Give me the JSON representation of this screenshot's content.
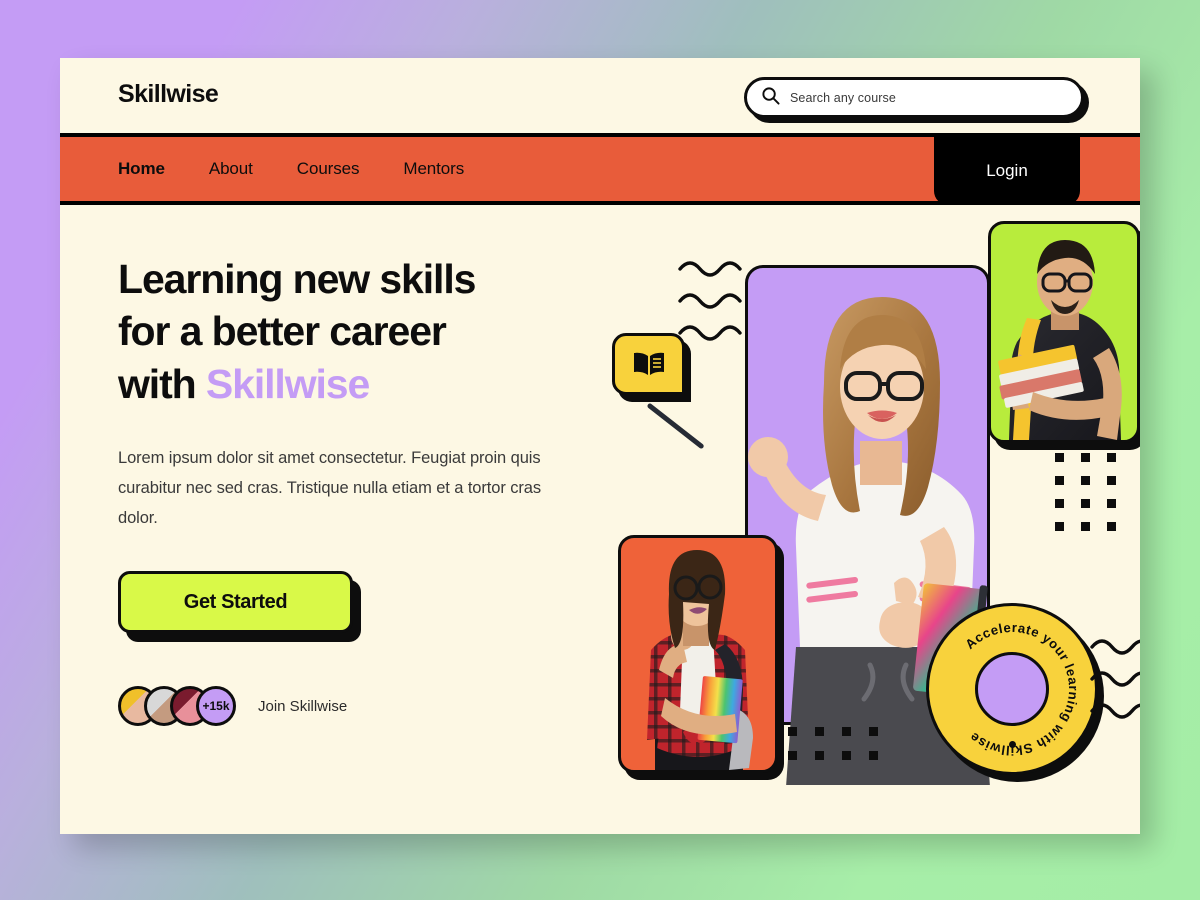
{
  "theme": {
    "page_bg_start": "#c49cf5",
    "page_bg_end": "#a7eea8",
    "card_bg": "#fdf8e4",
    "nav_bg": "#e85c3a",
    "ink": "#0d0d0d",
    "accent_purple": "#c49cf5",
    "accent_lime": "#d9f948",
    "accent_yellow": "#f8d23c",
    "accent_green": "#b8ec3c",
    "accent_orange": "#ef6239"
  },
  "header": {
    "brand": "Skillwise",
    "search": {
      "placeholder": "Search any course",
      "value": "",
      "icon": "search-icon"
    }
  },
  "nav": {
    "items": [
      {
        "label": "Home",
        "active": true
      },
      {
        "label": "About",
        "active": false
      },
      {
        "label": "Courses",
        "active": false
      },
      {
        "label": "Mentors",
        "active": false
      }
    ],
    "login_label": "Login"
  },
  "hero": {
    "headline_line1": "Learning new skills",
    "headline_line2": "for a better career",
    "headline_line3_prefix": "with ",
    "headline_line3_accent": "Skillwise",
    "paragraph": "Lorem ipsum dolor sit amet consectetur. Feugiat proin quis curabitur nec sed cras. Tristique nulla etiam et a tortor cras dolor.",
    "cta_label": "Get Started",
    "social_proof": {
      "count_label": "+15k",
      "text": "Join Skillwise"
    },
    "badge_text": "Accelerate your learning with Skillwise",
    "bubble_icon": "open-book-icon",
    "decorations": {
      "wave_groups": 2,
      "dot_grid_right": {
        "cols": 3,
        "rows": 4
      },
      "dot_grid_bottom": {
        "cols": 4,
        "rows": 2
      }
    },
    "photos": [
      {
        "name": "student-woman-pointing",
        "bg": "#c49cf5"
      },
      {
        "name": "student-man-books",
        "bg": "#b8ec3c"
      },
      {
        "name": "student-woman-thinking",
        "bg": "#ef6239"
      }
    ]
  }
}
